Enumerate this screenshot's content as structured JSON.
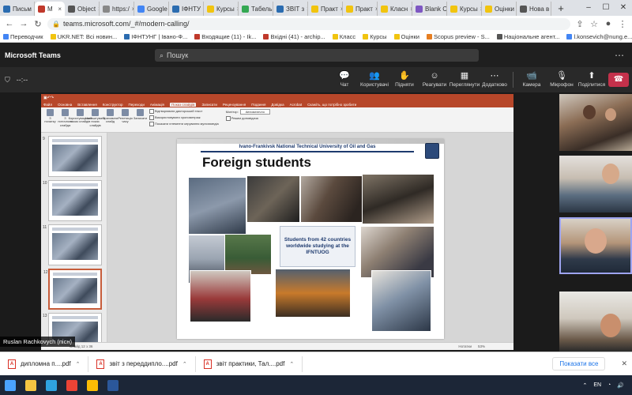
{
  "browser": {
    "tabs": [
      {
        "label": "Письм",
        "color": "#2b6cb0"
      },
      {
        "label": "М",
        "color": "#c0392b"
      },
      {
        "label": "Object",
        "color": "#555555"
      },
      {
        "label": "https:/",
        "color": "#888888"
      },
      {
        "label": "Google",
        "color": "#4285f4"
      },
      {
        "label": "ІФНТУ",
        "color": "#2b6cb0"
      },
      {
        "label": "Курсы",
        "color": "#f1c40f"
      },
      {
        "label": "Табель",
        "color": "#34a853"
      },
      {
        "label": "ЗВІТ з",
        "color": "#2b6cb0"
      },
      {
        "label": "Практ",
        "color": "#f1c40f"
      },
      {
        "label": "Практ",
        "color": "#f1c40f"
      },
      {
        "label": "Класн",
        "color": "#f1c40f"
      },
      {
        "label": "Blank C",
        "color": "#7e57c2"
      },
      {
        "label": "Курсы",
        "color": "#f1c40f"
      },
      {
        "label": "Оцінки",
        "color": "#f1c40f"
      },
      {
        "label": "Нова в",
        "color": "#555555"
      }
    ],
    "active_tab_index": 1,
    "url": "teams.microsoft.com/_#/modern-calling/",
    "bookmarks": [
      {
        "label": "Переводчик",
        "color": "#4285f4"
      },
      {
        "label": "UKR.NET: Всі новин...",
        "color": "#f1c40f"
      },
      {
        "label": "ІФНТУНГ | Івано-Ф...",
        "color": "#2b6cb0"
      },
      {
        "label": "Входящие (11) - Ik...",
        "color": "#c0392b"
      },
      {
        "label": "Вхідні (41) - archip...",
        "color": "#c0392b"
      },
      {
        "label": "Класс",
        "color": "#f1c40f"
      },
      {
        "label": "Курсы",
        "color": "#f1c40f"
      },
      {
        "label": "Оцінки",
        "color": "#f1c40f"
      },
      {
        "label": "Scopus preview - S...",
        "color": "#e67e22"
      },
      {
        "label": "Національне агент...",
        "color": "#555555"
      },
      {
        "label": "l.konsevich@nung.e...",
        "color": "#4285f4"
      }
    ]
  },
  "teams": {
    "app_title": "Microsoft Teams",
    "search_placeholder": "Пошук",
    "timer": "--:--",
    "controls": [
      {
        "label": "Чат",
        "icon": "chat-icon",
        "glyph": "💬"
      },
      {
        "label": "Користувачі",
        "icon": "people-icon",
        "glyph": "👥"
      },
      {
        "label": "Підняти",
        "icon": "raise-hand-icon",
        "glyph": "✋"
      },
      {
        "label": "Реагувати",
        "icon": "react-icon",
        "glyph": "☺"
      },
      {
        "label": "Переглянути",
        "icon": "view-icon",
        "glyph": "▦"
      },
      {
        "label": "Додатково",
        "icon": "more-icon",
        "glyph": "⋯"
      }
    ],
    "media_controls": [
      {
        "label": "Камера",
        "icon": "camera-icon",
        "glyph": "📹"
      },
      {
        "label": "Мікрофон",
        "icon": "microphone-icon",
        "glyph": "🎙"
      },
      {
        "label": "Поділитися",
        "icon": "share-icon",
        "glyph": "⬆"
      }
    ],
    "presenter_label": "Ruslan Rachkovych (пісн)"
  },
  "powerpoint": {
    "ribbon_tabs": [
      "Файл",
      "Основна",
      "Вставлення",
      "Конструктор",
      "Переходи",
      "Анімація",
      "Показ слайдів",
      "Записати",
      "Рецензування",
      "Подання",
      "Довідка",
      "Acrobat",
      "Скажіть, що потрібно зробити"
    ],
    "selected_tab": "Показ слайдів",
    "ribbon_buttons": [
      "З початку",
      "З поточного слайда",
      "Користувацький показ слайдів",
      "Налаштувати показ слайдів",
      "Приховати слайд",
      "Репетиція часу",
      "Записати"
    ],
    "ribbon_checks": [
      "Відтворювати дикторський текст",
      "Використовувати хронометраж",
      "Показати елементи керування мультимедіа"
    ],
    "monitor_label": "Монітор:",
    "monitor_value": "Автоматично",
    "presenter_view_label": "Режим доповідача",
    "thumbnails": [
      {
        "num": "9"
      },
      {
        "num": "10"
      },
      {
        "num": "11"
      },
      {
        "num": "12"
      },
      {
        "num": "13"
      }
    ],
    "selected_thumbnail": "12",
    "slide": {
      "university": "Ivano-Frankivsk National Technical University of Oil and Gas",
      "title": "Foreign students",
      "caption": "Students from 42 countries worldwide studying at the IFNTUOG"
    },
    "status": {
      "left": "Слайд 12 з 36",
      "notes": "Нотатки",
      "zoom": "53%"
    }
  },
  "downloads": [
    {
      "name": "дипломна п....pdf"
    },
    {
      "name": "звіт з переддипло....pdf"
    },
    {
      "name": "звіт практики, Тал....pdf"
    }
  ],
  "show_all_label": "Показати все",
  "taskbar": {
    "apps": [
      {
        "icon": "start-icon",
        "color": "#4aa3ff"
      },
      {
        "icon": "file-explorer-icon",
        "color": "#f4c542"
      },
      {
        "icon": "edge-icon",
        "color": "#2fa3e0"
      },
      {
        "icon": "chrome-icon",
        "color": "#ea4335"
      },
      {
        "icon": "chrome-profile-icon",
        "color": "#fbbc05"
      },
      {
        "icon": "word-icon",
        "color": "#2b579a"
      }
    ],
    "lang": "EN"
  }
}
